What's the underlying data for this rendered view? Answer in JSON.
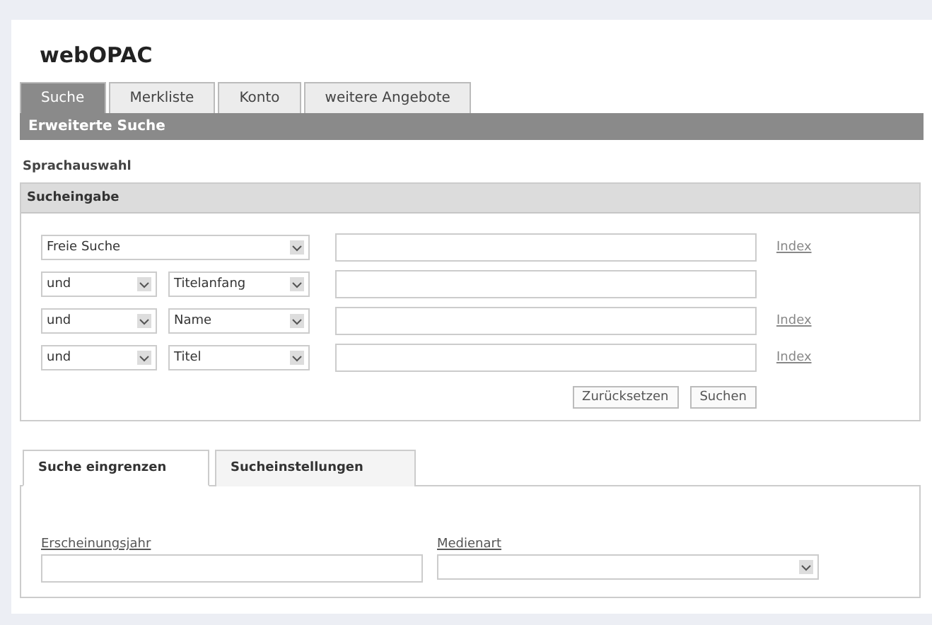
{
  "title": "webOPAC",
  "tabs": [
    {
      "label": "Suche",
      "selected": true
    },
    {
      "label": "Merkliste",
      "selected": false
    },
    {
      "label": "Konto",
      "selected": false
    },
    {
      "label": "weitere Angebote",
      "selected": false
    }
  ],
  "section_bar": "Erweiterte Suche",
  "language_link": "Sprachauswahl",
  "search_panel": {
    "title": "Sucheingabe",
    "rows": [
      {
        "operator": null,
        "field": "Freie Suche",
        "index_link": "Index"
      },
      {
        "operator": "und",
        "field": "Titelanfang",
        "index_link": null
      },
      {
        "operator": "und",
        "field": "Name",
        "index_link": "Index"
      },
      {
        "operator": "und",
        "field": "Titel",
        "index_link": "Index"
      }
    ],
    "buttons": [
      "Zurücksetzen",
      "Suchen"
    ]
  },
  "lower_tabs": [
    {
      "label": "Suche eingrenzen",
      "selected": true
    },
    {
      "label": "Sucheinstellungen",
      "selected": false
    }
  ],
  "filters": [
    {
      "kind": "text",
      "label": "Erscheinungsjahr"
    },
    {
      "kind": "select",
      "label": "Medienart"
    }
  ]
}
